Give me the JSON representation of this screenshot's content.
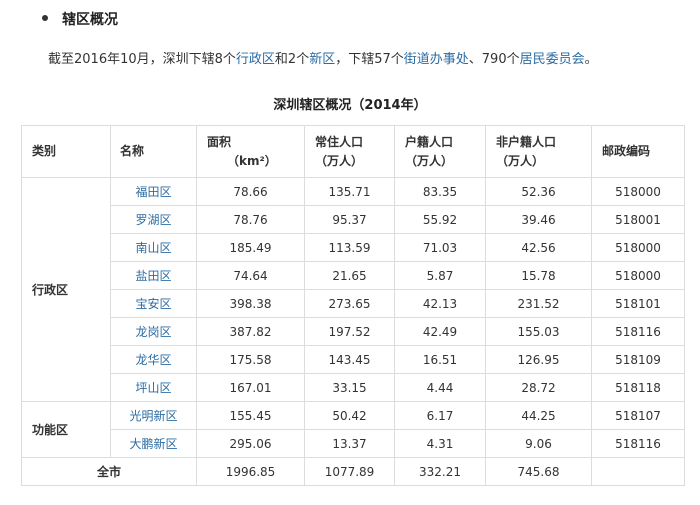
{
  "section": {
    "heading": "辖区概况"
  },
  "intro": {
    "t1": "截至2016年10月，深圳下辖8个",
    "l1": "行政区",
    "t2": "和2个",
    "l2": "新区",
    "t3": "，下辖57个",
    "l3": "街道办事处",
    "t4": "、790个",
    "l4": "居民委员会",
    "t5": "。"
  },
  "table": {
    "title": "深圳辖区概况（2014年）",
    "headers": {
      "category": "类别",
      "name": "名称",
      "area_1": "面积",
      "area_2": "（km²）",
      "pop_1": "常住人口",
      "pop_2": "（万人）",
      "hh_1": "户籍人口",
      "hh_2": "（万人）",
      "nonhh_1": "非户籍人口",
      "nonhh_2": "（万人）",
      "postcode": "邮政编码"
    },
    "groups": [
      {
        "category": "行政区",
        "rows": [
          {
            "name": "福田区",
            "area": "78.66",
            "pop": "135.71",
            "hh": "83.35",
            "nonhh": "52.36",
            "post": "518000"
          },
          {
            "name": "罗湖区",
            "area": "78.76",
            "pop": "95.37",
            "hh": "55.92",
            "nonhh": "39.46",
            "post": "518001"
          },
          {
            "name": "南山区",
            "area": "185.49",
            "pop": "113.59",
            "hh": "71.03",
            "nonhh": "42.56",
            "post": "518000"
          },
          {
            "name": "盐田区",
            "area": "74.64",
            "pop": "21.65",
            "hh": "5.87",
            "nonhh": "15.78",
            "post": "518000"
          },
          {
            "name": "宝安区",
            "area": "398.38",
            "pop": "273.65",
            "hh": "42.13",
            "nonhh": "231.52",
            "post": "518101"
          },
          {
            "name": "龙岗区",
            "area": "387.82",
            "pop": "197.52",
            "hh": "42.49",
            "nonhh": "155.03",
            "post": "518116"
          },
          {
            "name": "龙华区",
            "area": "175.58",
            "pop": "143.45",
            "hh": "16.51",
            "nonhh": "126.95",
            "post": "518109"
          },
          {
            "name": "坪山区",
            "area": "167.01",
            "pop": "33.15",
            "hh": "4.44",
            "nonhh": "28.72",
            "post": "518118"
          }
        ]
      },
      {
        "category": "功能区",
        "rows": [
          {
            "name": "光明新区",
            "area": "155.45",
            "pop": "50.42",
            "hh": "6.17",
            "nonhh": "44.25",
            "post": "518107"
          },
          {
            "name": "大鹏新区",
            "area": "295.06",
            "pop": "13.37",
            "hh": "4.31",
            "nonhh": "9.06",
            "post": "518116"
          }
        ]
      }
    ],
    "total": {
      "label": "全市",
      "area": "1996.85",
      "pop": "1077.89",
      "hh": "332.21",
      "nonhh": "745.68",
      "post": ""
    }
  }
}
